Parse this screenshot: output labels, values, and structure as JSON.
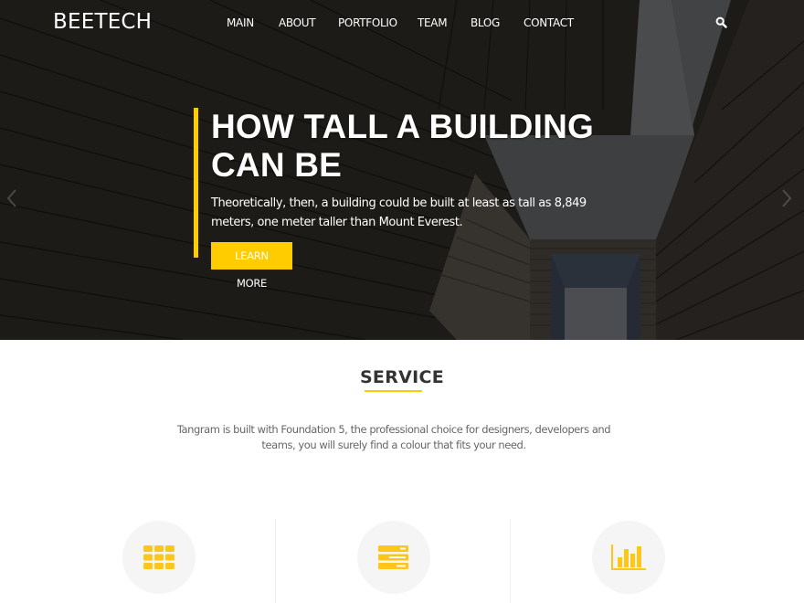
{
  "brand": {
    "name": "BEETECH",
    "accent": "#ffcc00"
  },
  "nav": {
    "items": [
      {
        "label": "MAIN"
      },
      {
        "label": "ABOUT"
      },
      {
        "label": "PORTFOLIO"
      },
      {
        "label": "TEAM"
      },
      {
        "label": "BLOG"
      },
      {
        "label": "CONTACT"
      }
    ],
    "search_icon": "search-icon"
  },
  "hero": {
    "title_line1": "HOW TALL A BUILDING",
    "title_line2": "CAN BE",
    "text": "Theoretically, then, a building could be built at least as tall as 8,849 meters, one meter taller than Mount Everest.",
    "button_label": "LEARN MORE",
    "prev_icon": "chevron-left-icon",
    "next_icon": "chevron-right-icon"
  },
  "service": {
    "title": "SERVICE",
    "description": "Tangram is built with Foundation 5, the professional choice for designers, developers and teams, you will surely find a colour that fits your need.",
    "items": [
      {
        "icon": "grid-icon"
      },
      {
        "icon": "server-list-icon"
      },
      {
        "icon": "bar-chart-icon"
      }
    ]
  }
}
